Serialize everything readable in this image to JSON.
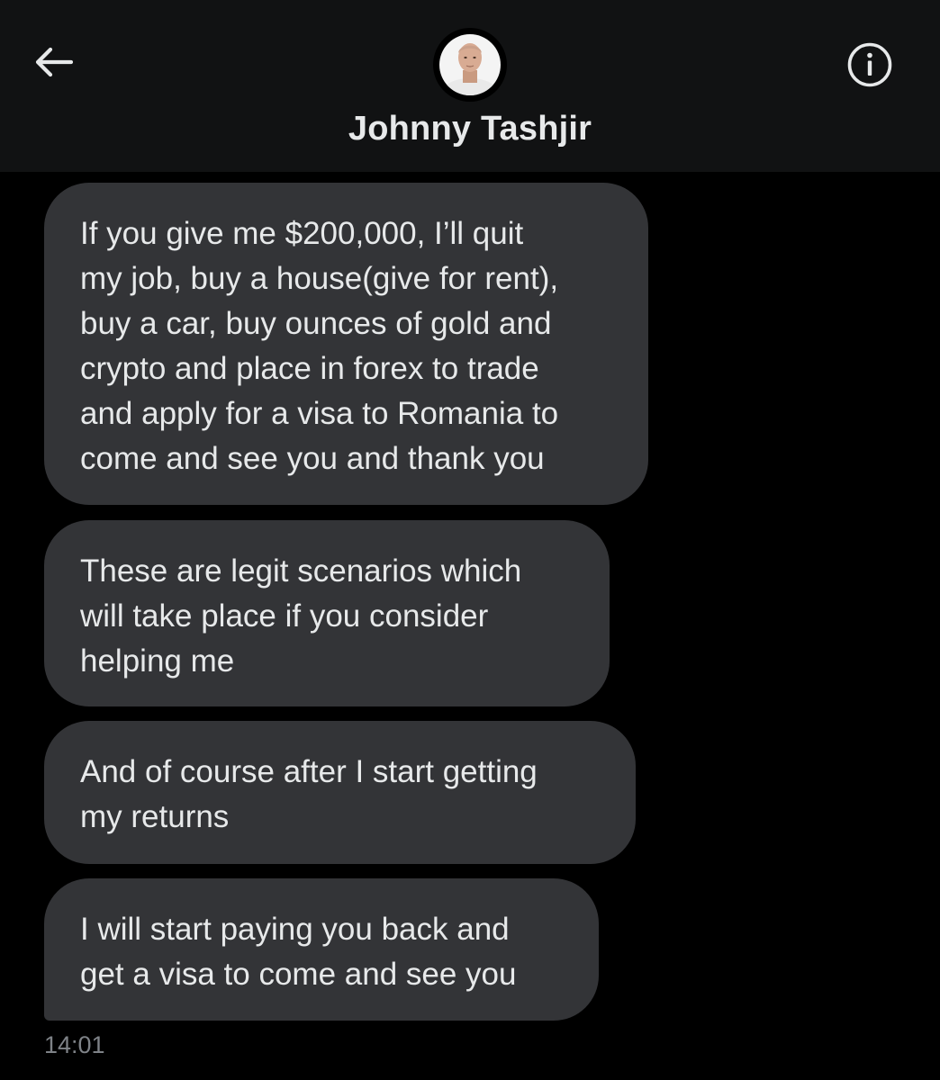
{
  "header": {
    "contact_name": "Johnny Tashjir",
    "back_icon": "arrow-left-icon",
    "info_icon": "info-circle-icon"
  },
  "messages": [
    {
      "text": "If you give me $200,000, I’ll quit\nmy job, buy a house(give for rent),\nbuy a car, buy ounces of gold and\ncrypto and place in forex to trade\nand apply for a visa to Romania to\ncome and see you and thank you"
    },
    {
      "text": "These are legit scenarios which\nwill take place if you consider\nhelping me"
    },
    {
      "text": "And of course after I start getting\nmy returns"
    },
    {
      "text": "I will start paying you back and\nget a visa to come and see you"
    }
  ],
  "timestamp": "14:01",
  "colors": {
    "background": "#000000",
    "header_background": "#111213",
    "bubble": "#333437",
    "text": "#e7e9ea",
    "muted_text": "#7e8287"
  }
}
